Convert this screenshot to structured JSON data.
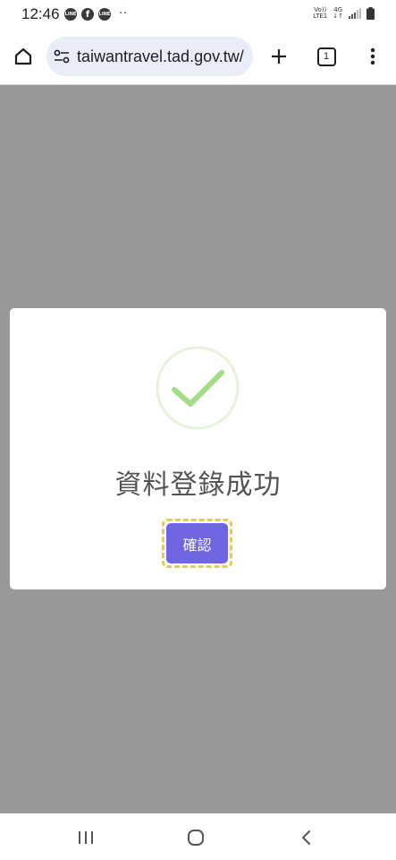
{
  "status_bar": {
    "time": "12:46",
    "notification_icons": [
      "line-icon",
      "facebook-icon",
      "line-icon"
    ],
    "notification_labels": [
      "LINE",
      "f",
      "LINE"
    ],
    "more_notifications": "··",
    "volte_label": "Vo))",
    "lte_label": "LTE1",
    "network_label": "4G",
    "signal_icon": "signal-strength-icon",
    "battery_icon": "battery-icon"
  },
  "browser": {
    "home_icon": "home-icon",
    "site_settings_icon": "site-info-icon",
    "url": "taiwantravel.tad.gov.tw/",
    "new_tab_icon": "plus-icon",
    "tab_count": "1",
    "menu_icon": "more-vert-icon"
  },
  "dialog": {
    "status_icon": "check-circle-icon",
    "title": "資料登錄成功",
    "confirm_label": "確認",
    "colors": {
      "confirm_bg": "#7065e0",
      "focus_ring": "#f2cc2e",
      "check": "#a5dc86",
      "overlay": "#999999"
    }
  },
  "nav_bar": {
    "recents_icon": "recents-icon",
    "home_icon": "home-circle-icon",
    "back_icon": "back-chevron-icon"
  }
}
